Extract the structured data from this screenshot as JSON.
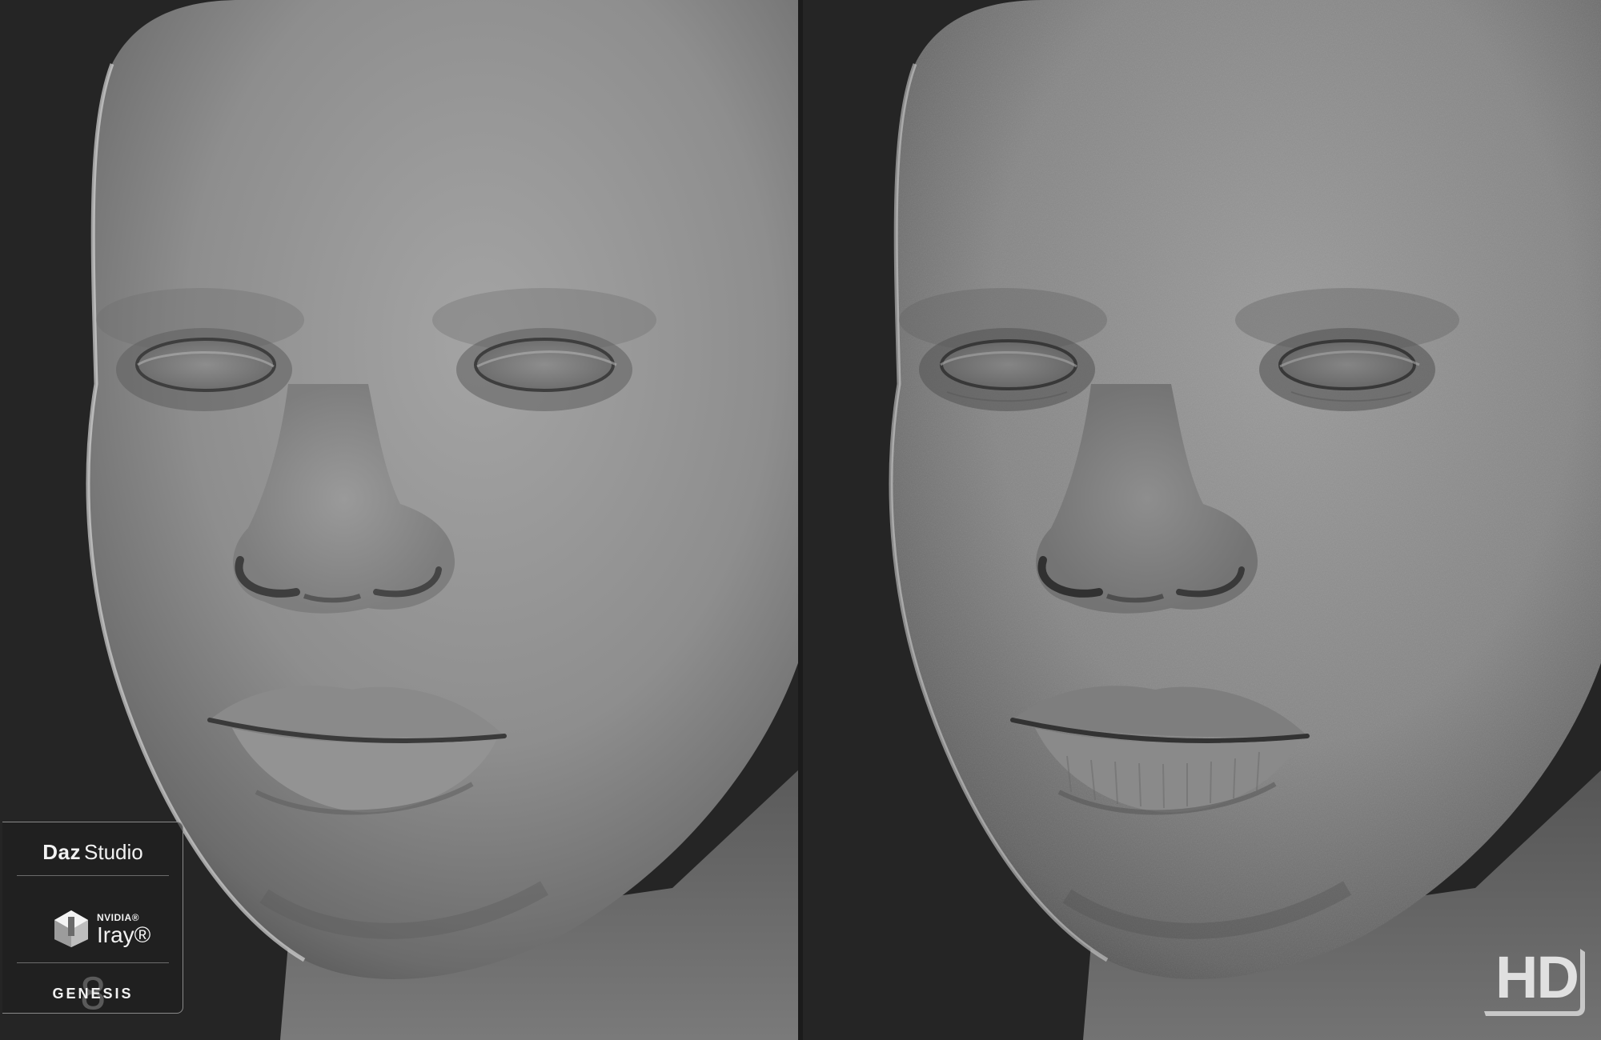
{
  "comparison": {
    "left_view": "base-mesh-render",
    "right_view": "hd-detail-render"
  },
  "logo_card": {
    "daz_word": "Daz",
    "studio_word": "Studio",
    "nvidia_word": "NVIDIA®",
    "iray_word": "Iray®",
    "genesis_numeral": "8",
    "genesis_word": "GENESIS"
  },
  "hd_badge": {
    "text": "HD"
  },
  "colors": {
    "background": "#242424",
    "skin_light": "#9e9e9e",
    "skin_mid": "#7a7a7a",
    "skin_shadow": "#3c3c3c",
    "logo_text": "#f2f2f2"
  }
}
